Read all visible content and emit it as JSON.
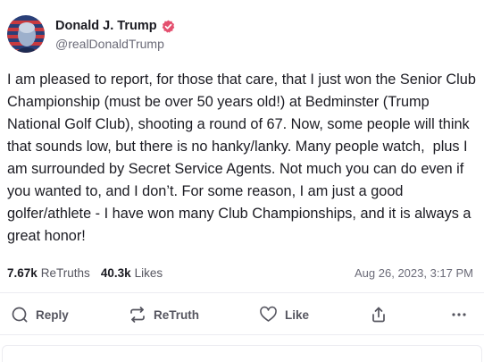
{
  "post": {
    "author": {
      "display_name": "Donald J. Trump",
      "handle": "@realDonaldTrump",
      "verified": true
    },
    "text": "I am pleased to report, for those that care, that I just won the Senior Club Championship (must be over 50 years old!) at Bedminster (Trump National Golf Club), shooting a round of 67. Now, some people will think that sounds low, but there is no hanky/lanky. Many people watch,  plus I am surrounded by Secret Service Agents. Not much you can do even if you wanted to, and I don’t. For some reason, I am just a good golfer/athlete - I have won many Club Championships, and it is always a great honor!",
    "stats": {
      "retruths_count": "7.67k",
      "retruths_label": "ReTruths",
      "likes_count": "40.3k",
      "likes_label": "Likes"
    },
    "timestamp": "Aug 26, 2023, 3:17 PM"
  },
  "actions": {
    "reply_label": "Reply",
    "retruth_label": "ReTruth",
    "like_label": "Like"
  },
  "icons": {
    "verified": "verified-badge-icon",
    "reply": "speech-bubble-icon",
    "retruth": "repost-arrows-icon",
    "like": "heart-icon",
    "share": "share-upload-icon",
    "more": "ellipsis-icon"
  },
  "colors": {
    "verified_badge": "#e4506f",
    "muted_text": "#6b6b78",
    "action_text": "#55555f",
    "divider": "#ececf1"
  }
}
